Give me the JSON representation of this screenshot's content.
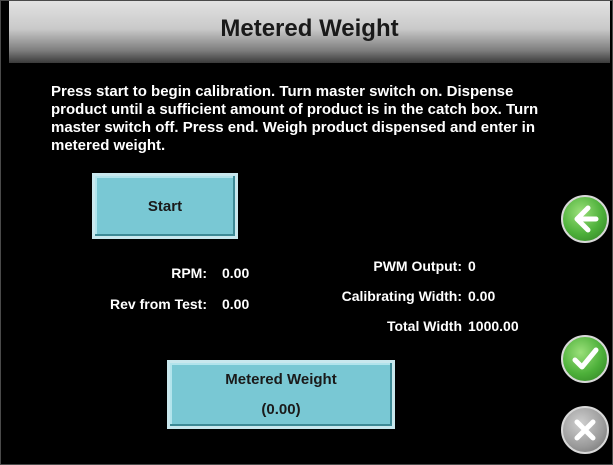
{
  "header": {
    "title": "Metered Weight"
  },
  "instructions": "Press start to begin calibration. Turn master switch on. Dispense product until a sufficient amount of product is in the catch box. Turn master switch off. Press end. Weigh product dispensed and enter in metered weight.",
  "start_button": {
    "label": "Start"
  },
  "readouts": {
    "rpm": {
      "label": "RPM:",
      "value": "0.00"
    },
    "rev_from_test": {
      "label": "Rev from Test:",
      "value": "0.00"
    },
    "pwm_output": {
      "label": "PWM Output:",
      "value": "0"
    },
    "calibrating_width": {
      "label": "Calibrating Width:",
      "value": "0.00"
    },
    "total_width": {
      "label": "Total Width",
      "value": "1000.00"
    }
  },
  "metered_weight_button": {
    "label": "Metered Weight",
    "value": "(0.00)"
  },
  "side_buttons": {
    "back": "back-arrow-icon",
    "accept": "checkmark-icon",
    "cancel": "close-icon"
  },
  "colors": {
    "background": "#000000",
    "button_fill": "#79c8d4",
    "accept_green": "#4db03a",
    "cancel_gray": "#9a9a9a"
  }
}
